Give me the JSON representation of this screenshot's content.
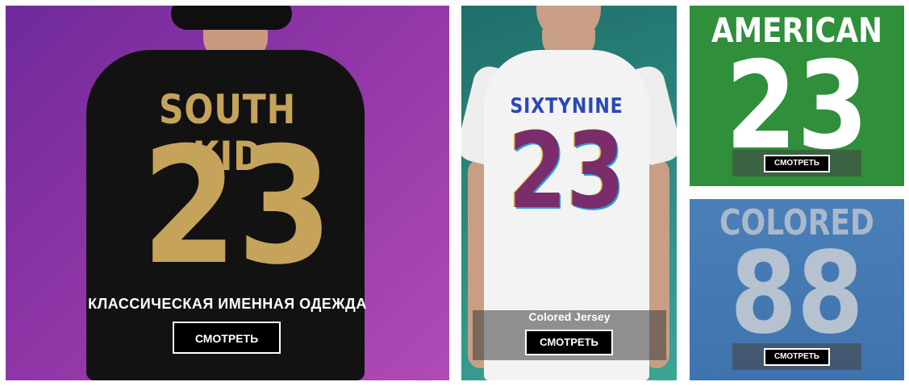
{
  "tiles": [
    {
      "jersey_name": "SOUTH KID",
      "jersey_number": "23",
      "title": "КЛАССИЧЕСКАЯ ИМЕННАЯ ОДЕЖДА",
      "button_label": "СМОТРЕТЬ"
    },
    {
      "jersey_name": "SIXTYNINE",
      "jersey_number": "23",
      "title": "Colored Jersey",
      "button_label": "СМОТРЕТЬ"
    },
    {
      "jersey_name": "AMERICAN",
      "jersey_number": "23",
      "button_label": "СМОТРЕТЬ"
    },
    {
      "jersey_name": "COLORED",
      "jersey_number": "88",
      "button_label": "СМОТРЕТЬ"
    }
  ],
  "colors": {
    "tile1_bg": "#8f35a6",
    "tile2_bg": "#2f8d82",
    "tile3_bg": "#2f8f3a",
    "tile4_bg": "#4b7fb8",
    "gold_print": "#c5a35a"
  }
}
